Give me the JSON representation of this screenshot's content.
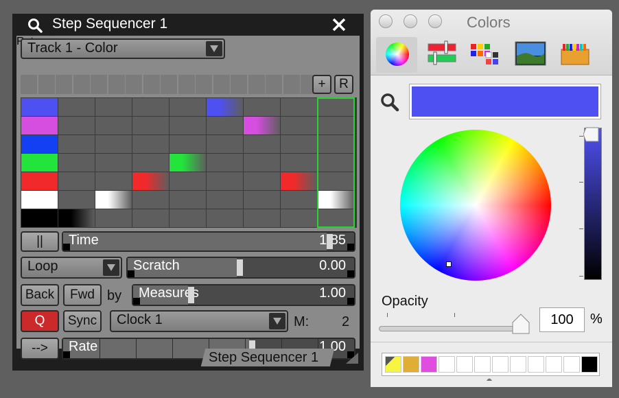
{
  "sequencer": {
    "title": "Step Sequencer 1",
    "track_dropdown": "Track 1 - Color",
    "add_label": "+",
    "reset_label": "R",
    "pause_label": "||",
    "time": {
      "label": "Time",
      "value": "1.85",
      "level": 0.94
    },
    "loop_dropdown": "Loop",
    "scratch": {
      "label": "Scratch",
      "value": "0.00",
      "level": 0.5
    },
    "back_label": "Back",
    "fwd_label": "Fwd",
    "by_label": "by",
    "measures": {
      "label": "Measures",
      "value": "1.00",
      "level": 0.25
    },
    "q_label": "Q",
    "sync_label": "Sync",
    "clock_dropdown": "Clock 1",
    "m_label": "M:",
    "m_value": "2",
    "arrow_label": "-->",
    "rate": {
      "label": "Rate",
      "value": "1.00",
      "level": 0.66
    },
    "footer_tab": "Step Sequencer 1",
    "row_colors": [
      "#4f50f2",
      "#d64ee0",
      "#1240f2",
      "#22e43b",
      "#f2292a",
      "#ffffff",
      "#000000"
    ],
    "grid": [
      [
        0,
        5
      ],
      [
        0,
        6
      ],
      [
        0
      ],
      [
        0,
        4
      ],
      [
        0,
        3,
        7
      ],
      [
        0,
        2,
        8
      ],
      [
        0,
        1
      ]
    ]
  },
  "colors_panel": {
    "title": "Colors",
    "selected_color": "#4f50f2",
    "opacity_label": "Opacity",
    "opacity_value": "100",
    "opacity_unit": "%",
    "toolbar": [
      "color-wheel-icon",
      "sliders-icon",
      "palettes-icon",
      "image-palette-icon",
      "crayons-icon"
    ],
    "swatches": [
      "#f5f542",
      "#e0ad35",
      "#e04ee0",
      "#ffffff",
      "#ffffff",
      "#ffffff",
      "#ffffff",
      "#ffffff",
      "#ffffff",
      "#ffffff",
      "#ffffff",
      "#000000"
    ]
  }
}
